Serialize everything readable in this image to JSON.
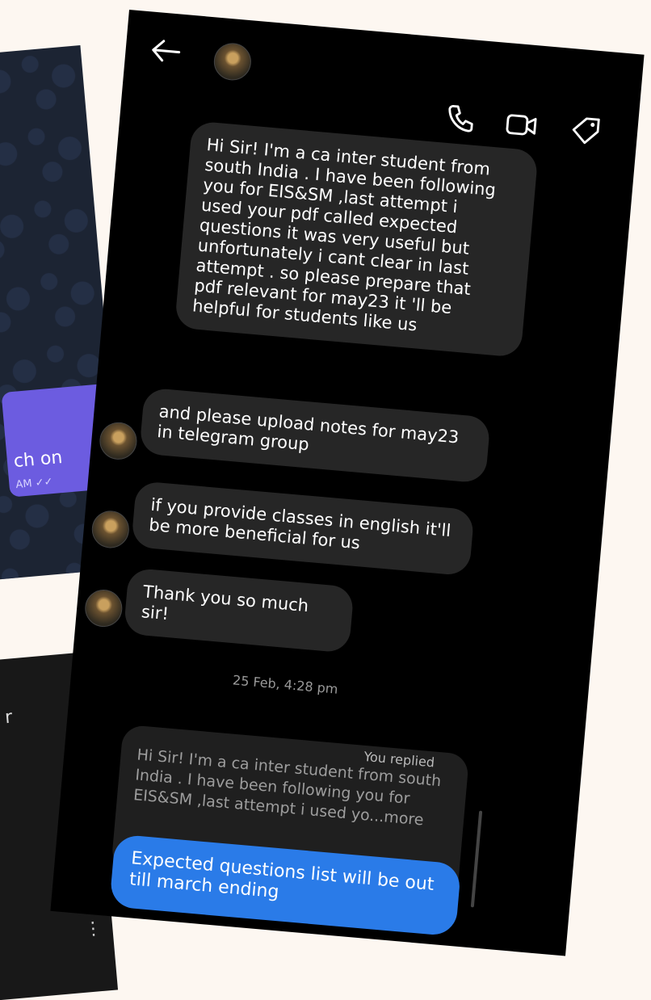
{
  "background_telegram": {
    "message_fragment": "ch on",
    "time_fragment": "AM ✓✓"
  },
  "background_phone2": {
    "fragment": "r",
    "menu_glyph": "⋮"
  },
  "chat": {
    "header_icons": [
      "back-arrow-icon",
      "phone-icon",
      "video-call-icon",
      "tag-icon"
    ],
    "messages": [
      {
        "text": "Hi Sir!  I'm a ca inter student from\nsouth India . I have been following\nyou for  EIS&SM ,last attempt i\nused your pdf called expected\nquestions it was very useful but\nunfortunately i cant clear in last\nattempt . so please prepare that\npdf relevant for may23 it 'll be\nhelpful for students like us"
      },
      {
        "text": "and please upload notes for may23\nin telegram group"
      },
      {
        "text": "if you provide classes in english it'll\nbe more beneficial for us"
      },
      {
        "text": "Thank you so much sir!"
      }
    ],
    "timestamp": "25 Feb, 4:28 pm",
    "reply": {
      "label": "You replied",
      "quoted": "Hi Sir!  I'm a ca inter student from south\nIndia . I have been following  you for\nEIS&SM ,last attempt i used yo...more",
      "text": "Expected questions list will be out\ntill march ending"
    }
  },
  "colors": {
    "page_bg": "#fdf7f1",
    "received_bubble": "#262626",
    "sent_bubble": "#2a7be8"
  }
}
